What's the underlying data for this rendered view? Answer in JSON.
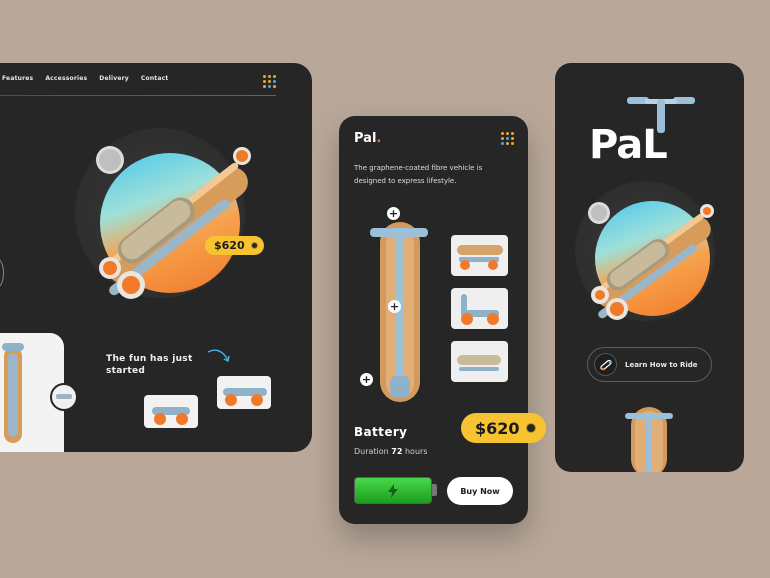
{
  "desktop": {
    "nav": [
      "Features",
      "Accessories",
      "Delivery",
      "Contact"
    ],
    "price": "$620",
    "headline": "The fun has just started"
  },
  "mobile_product": {
    "brand": "Pal",
    "brand_dot": ".",
    "tagline": "The graphene-coated fibre vehicle is designed to express lifestyle.",
    "hotspot_symbol": "+",
    "price": "$620",
    "battery_title": "Battery",
    "duration_label": "Duration",
    "duration_value": "72",
    "duration_unit": "hours",
    "buy_label": "Buy Now"
  },
  "mobile_hero": {
    "logo": "PaL",
    "learn_label": "Learn How to Ride"
  },
  "colors": {
    "background": "#b9a89a",
    "panel": "#262626",
    "accent_orange": "#f37521",
    "price_yellow": "#f7c331",
    "battery_green": "#2fc232"
  },
  "icons": [
    "menu-dots-icon",
    "lightning-icon",
    "skateboard-icon",
    "arrow-curve-icon"
  ]
}
